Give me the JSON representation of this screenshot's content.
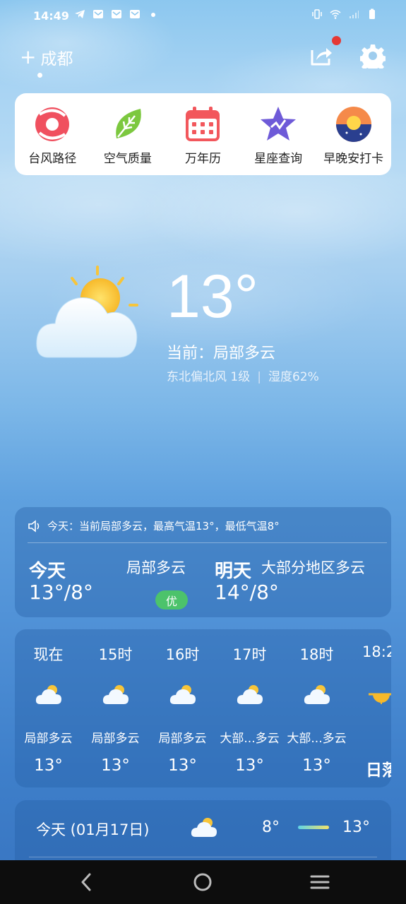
{
  "status_bar": {
    "time": "14:49",
    "icons_left": [
      "telegram-icon",
      "mail-icon",
      "mail-icon",
      "mail-icon",
      "dot-icon"
    ],
    "icons_right": [
      "vibrate-icon",
      "wifi-icon",
      "signal-icon",
      "battery-icon"
    ]
  },
  "header": {
    "city": "成都",
    "add_symbol": "+"
  },
  "quick_links": [
    {
      "label": "台风路径",
      "icon": "typhoon-icon"
    },
    {
      "label": "空气质量",
      "icon": "leaf-icon"
    },
    {
      "label": "万年历",
      "icon": "calendar-icon"
    },
    {
      "label": "星座查询",
      "icon": "star-icon"
    },
    {
      "label": "早晚安打卡",
      "icon": "sunrise-icon"
    }
  ],
  "current": {
    "temp": "13°",
    "condition": "当前：局部多云",
    "wind": "东北偏北风 1级",
    "humidity": "湿度62%"
  },
  "summary": {
    "announcement": "今天：当前局部多云，最高气温13°，最低气温8°",
    "today": {
      "name": "今天",
      "range": "13°/8°",
      "condition": "局部多云",
      "aqi": "优"
    },
    "tomorrow": {
      "name": "明天",
      "range": "14°/8°",
      "condition": "大部分地区多云"
    }
  },
  "hourly": [
    {
      "time": "现在",
      "cond": "局部多云",
      "temp": "13°"
    },
    {
      "time": "15时",
      "cond": "局部多云",
      "temp": "13°"
    },
    {
      "time": "16时",
      "cond": "局部多云",
      "temp": "13°"
    },
    {
      "time": "17时",
      "cond": "大部...多云",
      "temp": "13°"
    },
    {
      "time": "18时",
      "cond": "大部...多云",
      "temp": "13°"
    },
    {
      "time": "18:2",
      "cond": "",
      "temp": "日落"
    }
  ],
  "daily": [
    {
      "day": "今天 (01月17日)",
      "low": "8°",
      "high": "13°"
    }
  ],
  "colors": {
    "accent_red": "#e53935",
    "aqi_green": "#4cc36b"
  }
}
